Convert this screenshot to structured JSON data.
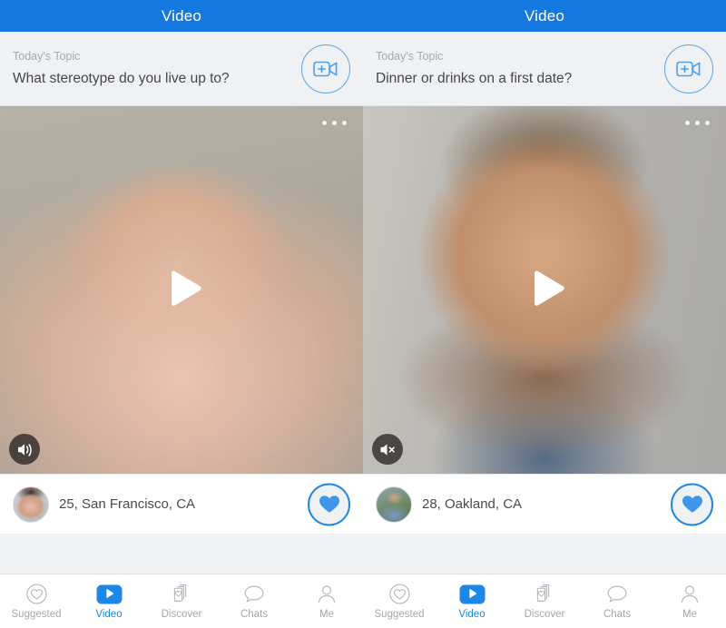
{
  "app": {
    "accent_blue": "#1c87ea",
    "header_blue": "#1378e0",
    "muted_gray": "#a6a7ac"
  },
  "panes": [
    {
      "header": {
        "title": "Video"
      },
      "topic": {
        "label": "Today's Topic",
        "question": "What stereotype do you live up to?",
        "record_icon": "video-camera-plus-icon"
      },
      "video": {
        "more_icon": "more-options-icon",
        "play_icon": "play-icon",
        "sound_icon": "speaker-on-icon",
        "muted": false
      },
      "profile": {
        "avatar_icon": "avatar",
        "info": "25, San Francisco, CA",
        "like_icon": "heart-icon"
      }
    },
    {
      "header": {
        "title": "Video"
      },
      "topic": {
        "label": "Today's Topic",
        "question": "Dinner or drinks on a first date?",
        "record_icon": "video-camera-plus-icon"
      },
      "video": {
        "more_icon": "more-options-icon",
        "play_icon": "play-icon",
        "sound_icon": "speaker-muted-icon",
        "muted": true
      },
      "profile": {
        "avatar_icon": "avatar",
        "info": "28, Oakland, CA",
        "like_icon": "heart-icon"
      }
    }
  ],
  "navbar": {
    "items": [
      {
        "label": "Suggested",
        "icon": "heart-circle-icon",
        "active": false
      },
      {
        "label": "Video",
        "icon": "video-play-icon",
        "active": true
      },
      {
        "label": "Discover",
        "icon": "cards-heart-icon",
        "active": false
      },
      {
        "label": "Chats",
        "icon": "chat-bubble-icon",
        "active": false
      },
      {
        "label": "Me",
        "icon": "person-icon",
        "active": false
      }
    ]
  }
}
